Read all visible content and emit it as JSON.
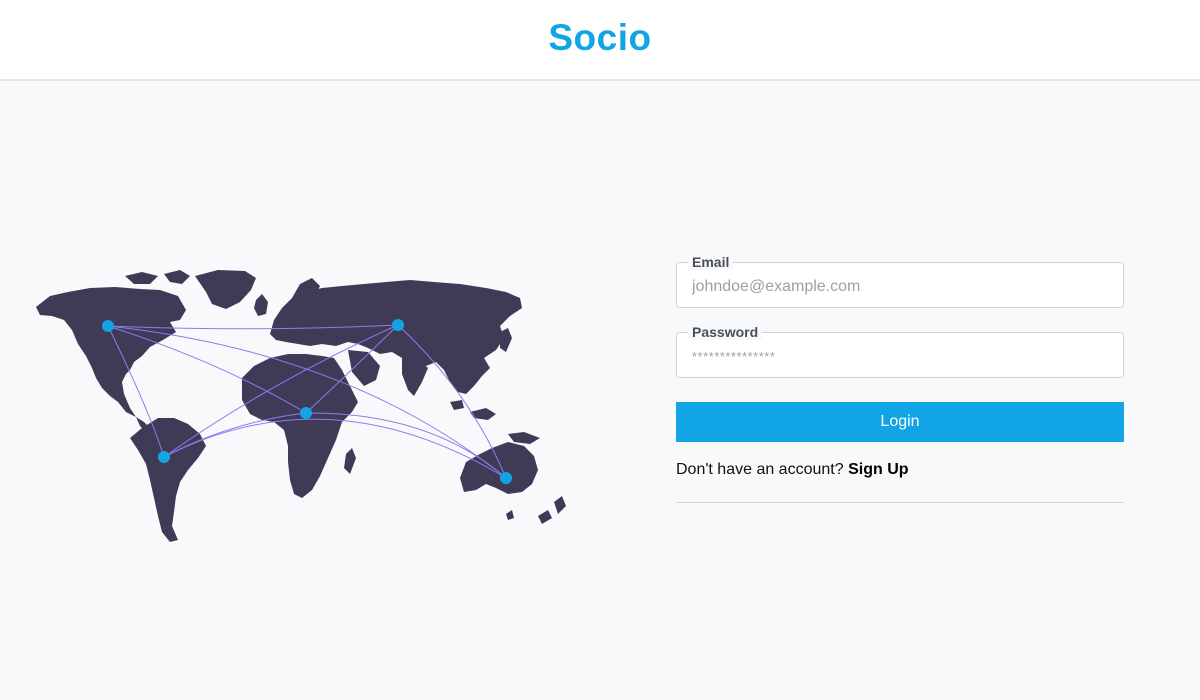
{
  "header": {
    "brand": "Socio"
  },
  "illustration": {
    "icon": "world-map-network",
    "land_color": "#3f3b56",
    "node_color": "#12a5e6",
    "link_color": "#8b7cf0"
  },
  "login_form": {
    "email": {
      "label": "Email",
      "placeholder": "johndoe@example.com"
    },
    "password": {
      "label": "Password",
      "placeholder": "***************"
    },
    "login_label": "Login",
    "signup_prompt": "Don't have an account?",
    "signup_link": "Sign Up"
  },
  "colors": {
    "accent": "#12a5e6",
    "background": "#f8f9fb"
  }
}
